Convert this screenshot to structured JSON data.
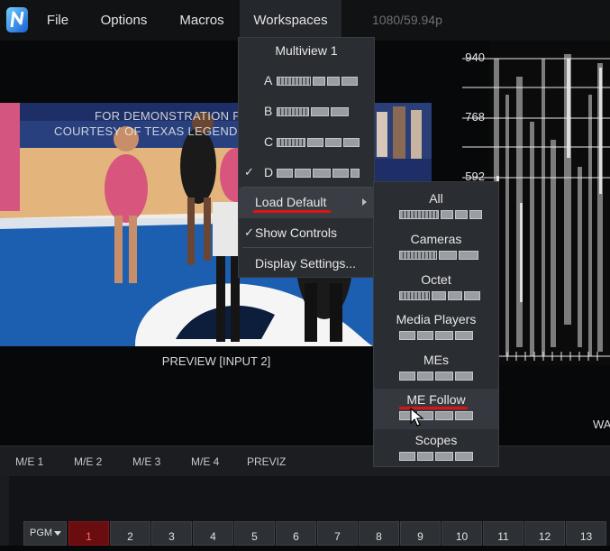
{
  "menubar": {
    "items": [
      {
        "label": "File"
      },
      {
        "label": "Options"
      },
      {
        "label": "Macros"
      },
      {
        "label": "Workspaces"
      }
    ],
    "video_format": "1080/59.94p"
  },
  "preview": {
    "watermark_line1": "FOR DEMONSTRATION P",
    "watermark_line2": "COURTESY OF TEXAS LEGEND",
    "label": "PREVIEW [INPUT 2]"
  },
  "waveform": {
    "labels": [
      "940",
      "768",
      "592"
    ],
    "partial_label": "WA"
  },
  "workspaces_menu": {
    "title": "Multiview 1",
    "multiviews": [
      {
        "letter": "A",
        "checked": false
      },
      {
        "letter": "B",
        "checked": false
      },
      {
        "letter": "C",
        "checked": false
      },
      {
        "letter": "D",
        "checked": true,
        "checkmark": "✓"
      }
    ],
    "load_default": "Load Default",
    "show_controls": "Show Controls",
    "show_controls_check": "✓",
    "display_settings": "Display Settings..."
  },
  "load_default_submenu": {
    "items": [
      {
        "label": "All"
      },
      {
        "label": "Cameras"
      },
      {
        "label": "Octet"
      },
      {
        "label": "Media Players"
      },
      {
        "label": "MEs"
      },
      {
        "label": "ME Follow"
      },
      {
        "label": "Scopes"
      }
    ]
  },
  "me_tabs": [
    "M/E 1",
    "M/E 2",
    "M/E 3",
    "M/E 4",
    "PREVIZ"
  ],
  "bus": {
    "selector": "PGM",
    "buttons": [
      "1",
      "2",
      "3",
      "4",
      "5",
      "6",
      "7",
      "8",
      "9",
      "10",
      "11",
      "12",
      "13"
    ],
    "active": "1"
  },
  "colors": {
    "accent_red": "#e01414",
    "active_button": "#6a0d10"
  }
}
